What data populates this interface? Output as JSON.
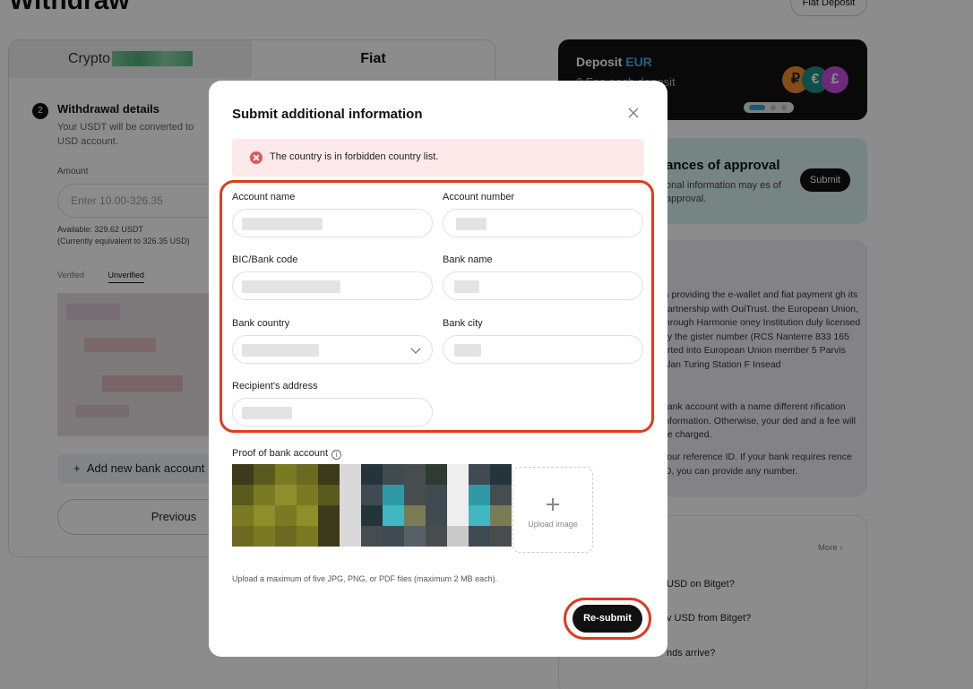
{
  "page": {
    "title": "Withdraw",
    "fiat_deposit": "Fiat Deposit"
  },
  "left_card": {
    "tabs": [
      {
        "label": "Crypto"
      },
      {
        "label": "Fiat"
      }
    ],
    "step_number": "2",
    "step_title": "Withdrawal details",
    "step_desc": "Your USDT will be converted to USD account.",
    "amount_label": "Amount",
    "amount_placeholder": "Enter 10.00-326.35",
    "available": "Available: 329.62 USDT",
    "equivalent": "(Currently equivalent to 326.35 USD)",
    "verify_tabs": [
      "Verified",
      "Unverified"
    ],
    "add_bank": "Add new bank account",
    "previous": "Previous"
  },
  "promo": {
    "title": "Deposit",
    "currency": "EUR",
    "subtitle": "0 Fee each deposit",
    "coins": [
      "₽",
      "€",
      "£"
    ]
  },
  "approval": {
    "title": "ances of approval",
    "desc": "onal information may es of approval.",
    "button": "Submit"
  },
  "info": {
    "p1": "is providing the e-wallet and fiat payment gh its partnership with OuiTrust. the European Union, through Harmonie oney Institution duly licensed by the gister number (RCS Nanterre 833 165 orted into European Union member 5 Parvis Alan Turing Station F Insead",
    "p2": "bank account with a name different rification information. Otherwise, your ded and a fee will be charged.",
    "p3": "your reference ID. If your bank requires rence ID, you can provide any number."
  },
  "faq": {
    "more": "More",
    "items": [
      "USD on Bitget?",
      "v USD from Bitget?",
      "nds arrive?"
    ]
  },
  "modal": {
    "title": "Submit additional information",
    "error": "The country is in forbidden country list.",
    "fields": {
      "account_name": "Account name",
      "account_number": "Account number",
      "bic": "BIC/Bank code",
      "bank_name": "Bank name",
      "bank_country": "Bank country",
      "bank_city": "Bank city",
      "recipient_address": "Recipient's address"
    },
    "proof_label": "Proof of bank account",
    "upload_image": "Upload image",
    "upload_hint": "Upload a maximum of five JPG, PNG, or PDF files (maximum 2 MB each).",
    "resubmit": "Re-submit"
  },
  "colors": {
    "highlight": "#e03a1e",
    "accent": "#3fb6e4",
    "error_bg": "#fde8ea"
  }
}
